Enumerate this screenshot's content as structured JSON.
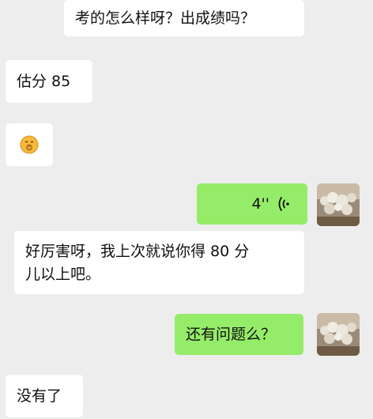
{
  "chat": {
    "messages": [
      {
        "sender": "other",
        "type": "text",
        "text": "考的怎么样呀？出成绩吗？"
      },
      {
        "sender": "other",
        "type": "text",
        "text": "估分 85"
      },
      {
        "sender": "other",
        "type": "emoji",
        "icon": "medal-emoji-icon"
      },
      {
        "sender": "self",
        "type": "voice",
        "duration": "4''",
        "icon": "voice-wave-icon"
      },
      {
        "sender": "other",
        "type": "text",
        "line1": "好厉害呀，我上次就说你得 80 分",
        "line2": "儿以上吧。"
      },
      {
        "sender": "self",
        "type": "text",
        "text": "还有问题么？"
      },
      {
        "sender": "other",
        "type": "text",
        "text": "没有了"
      }
    ]
  },
  "colors": {
    "background": "#ededed",
    "incoming_bubble": "#ffffff",
    "outgoing_bubble": "#95ec69",
    "text": "#111111"
  }
}
